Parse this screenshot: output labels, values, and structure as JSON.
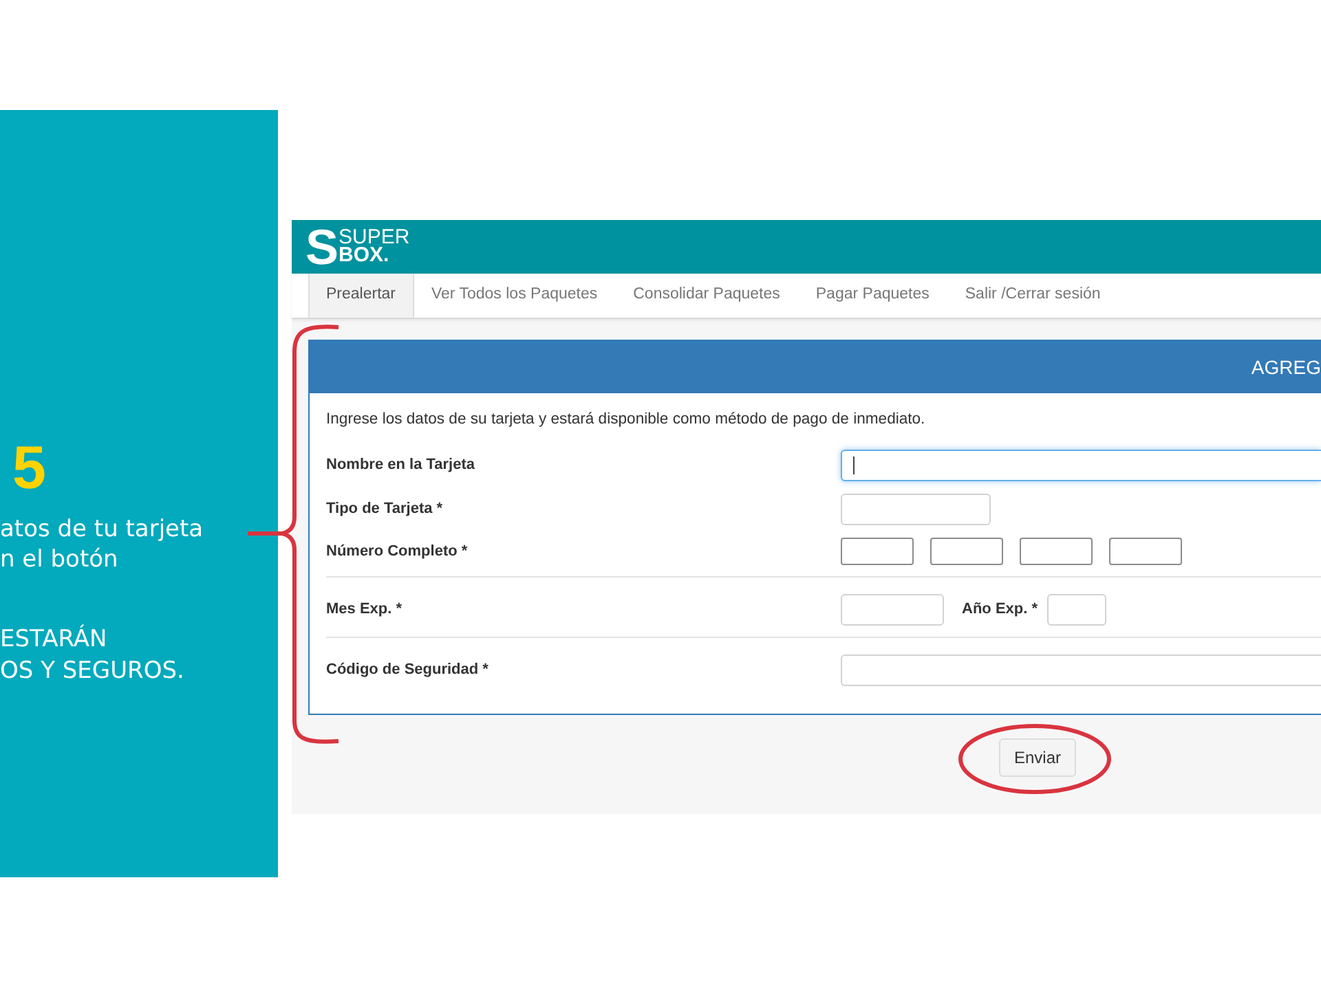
{
  "slide": {
    "step_number": "5",
    "instruction_lines": [
      "atos de tu tarjeta",
      "n el botón"
    ],
    "note_lines": [
      "ESTARÁN",
      "OS Y SEGUROS."
    ]
  },
  "app": {
    "logo": {
      "mark": "S",
      "line_1": "SUPER",
      "line_2": "BOX."
    },
    "nav_tabs": [
      {
        "label": "Prealertar",
        "selected": true
      },
      {
        "label": "Ver Todos los Paquetes",
        "selected": false
      },
      {
        "label": "Consolidar Paquetes",
        "selected": false
      },
      {
        "label": "Pagar Paquetes",
        "selected": false
      },
      {
        "label": "Salir /Cerrar sesión",
        "selected": false
      }
    ],
    "panel": {
      "title": "AGREG",
      "intro": "Ingrese los datos de su tarjeta y estará disponible como método de pago de inmediato.",
      "sections": [
        {
          "rows": [
            {
              "label": "Nombre en la Tarjeta",
              "controls": [
                {
                  "kind": "wide",
                  "focused": true
                }
              ]
            },
            {
              "label": "Tipo de Tarjeta *",
              "controls": [
                {
                  "kind": "medium",
                  "focused": false
                }
              ]
            },
            {
              "label": "Número Completo *",
              "controls": [
                {
                  "kind": "part",
                  "focused": false
                },
                {
                  "kind": "part",
                  "focused": false
                },
                {
                  "kind": "part",
                  "focused": false
                },
                {
                  "kind": "part",
                  "focused": false
                }
              ]
            }
          ]
        },
        {
          "rows": [
            {
              "label": "Mes Exp. *",
              "controls": [
                {
                  "kind": "month",
                  "focused": false
                },
                {
                  "kind": "label",
                  "text": "Año Exp. *"
                },
                {
                  "kind": "small",
                  "focused": false
                }
              ]
            }
          ]
        },
        {
          "rows": [
            {
              "label": "Código de Seguridad *",
              "controls": [
                {
                  "kind": "wide",
                  "focused": false
                }
              ]
            }
          ]
        }
      ]
    },
    "submit_button": {
      "label": "Enviar"
    }
  }
}
